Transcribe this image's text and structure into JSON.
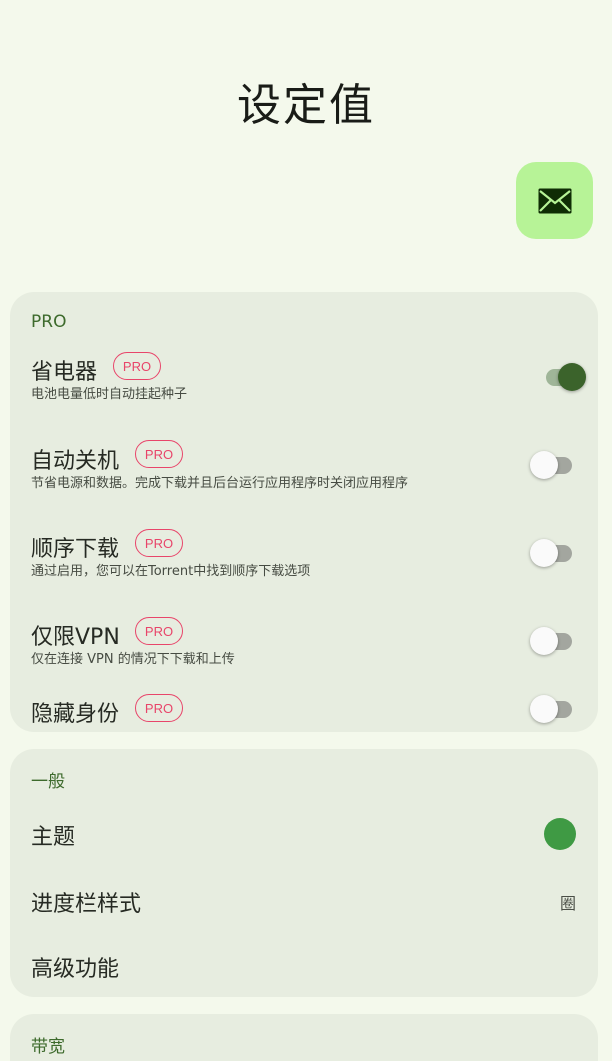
{
  "title": "设定值",
  "mail_icon": "envelope-icon",
  "pro_section": {
    "header": "PRO",
    "badge": "PRO",
    "items": [
      {
        "title": "省电器",
        "subtitle": "电池电量低时自动挂起种子",
        "enabled": true
      },
      {
        "title": "自动关机",
        "subtitle": "节省电源和数据。完成下载并且后台运行应用程序时关闭应用程序",
        "enabled": false
      },
      {
        "title": "顺序下载",
        "subtitle": "通过启用，您可以在Torrent中找到顺序下载选项",
        "enabled": false
      },
      {
        "title": "仅限VPN",
        "subtitle": "仅在连接 VPN 的情况下下载和上传",
        "enabled": false
      },
      {
        "title": "隐藏身份",
        "subtitle": "",
        "enabled": false
      }
    ]
  },
  "general_section": {
    "header": "一般",
    "theme_label": "主题",
    "theme_color": "#3f9a44",
    "progress_label": "进度栏样式",
    "progress_value": "圈",
    "advanced_label": "高级功能"
  },
  "bandwidth_section": {
    "header": "带宽"
  },
  "colors": {
    "background": "#f4f9ec",
    "card": "#e7ede0",
    "accent": "#3d6a2c",
    "pro_badge": "#e8456a",
    "fab": "#b7f397"
  }
}
